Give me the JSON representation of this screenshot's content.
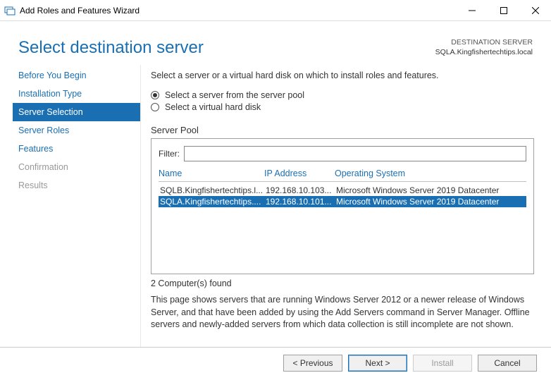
{
  "window": {
    "title": "Add Roles and Features Wizard"
  },
  "header": {
    "title": "Select destination server",
    "dest_label": "DESTINATION SERVER",
    "dest_server": "SQLA.Kingfishertechtips.local"
  },
  "sidebar": {
    "items": [
      {
        "label": "Before You Begin",
        "state": "enabled"
      },
      {
        "label": "Installation Type",
        "state": "enabled"
      },
      {
        "label": "Server Selection",
        "state": "active"
      },
      {
        "label": "Server Roles",
        "state": "enabled"
      },
      {
        "label": "Features",
        "state": "enabled"
      },
      {
        "label": "Confirmation",
        "state": "disabled"
      },
      {
        "label": "Results",
        "state": "disabled"
      }
    ]
  },
  "main": {
    "instruction": "Select a server or a virtual hard disk on which to install roles and features.",
    "radio1": "Select a server from the server pool",
    "radio2": "Select a virtual hard disk",
    "pool_header": "Server Pool",
    "filter_label": "Filter:",
    "filter_value": "",
    "columns": {
      "name": "Name",
      "ip": "IP Address",
      "os": "Operating System"
    },
    "rows": [
      {
        "name": "SQLB.Kingfishertechtips.l...",
        "ip": "192.168.10.103...",
        "os": "Microsoft Windows Server 2019 Datacenter",
        "selected": false
      },
      {
        "name": "SQLA.Kingfishertechtips....",
        "ip": "192.168.10.101...",
        "os": "Microsoft Windows Server 2019 Datacenter",
        "selected": true
      }
    ],
    "count": "2 Computer(s) found",
    "note": "This page shows servers that are running Windows Server 2012 or a newer release of Windows Server, and that have been added by using the Add Servers command in Server Manager. Offline servers and newly-added servers from which data collection is still incomplete are not shown."
  },
  "footer": {
    "prev": "< Previous",
    "next": "Next >",
    "install": "Install",
    "cancel": "Cancel"
  }
}
